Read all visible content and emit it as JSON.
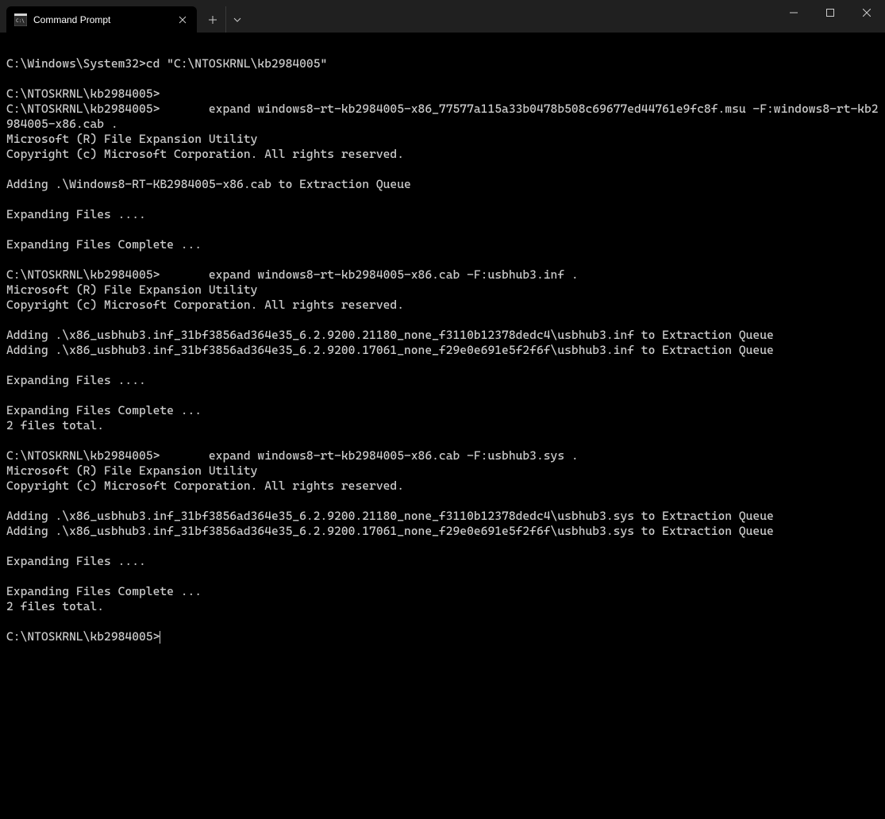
{
  "titlebar": {
    "tab_title": "Command Prompt"
  },
  "terminal": {
    "lines": [
      "C:\\Windows\\System32>cd \"C:\\NTOSKRNL\\kb2984005\"",
      "",
      "C:\\NTOSKRNL\\kb2984005>",
      "C:\\NTOSKRNL\\kb2984005>       expand windows8-rt-kb2984005-x86_77577a115a33b0478b508c69677ed44761e9fc8f.msu -F:windows8-rt-kb2984005-x86.cab .",
      "Microsoft (R) File Expansion Utility",
      "Copyright (c) Microsoft Corporation. All rights reserved.",
      "",
      "Adding .\\Windows8-RT-KB2984005-x86.cab to Extraction Queue",
      "",
      "Expanding Files ....",
      "",
      "Expanding Files Complete ...",
      "",
      "C:\\NTOSKRNL\\kb2984005>       expand windows8-rt-kb2984005-x86.cab -F:usbhub3.inf .",
      "Microsoft (R) File Expansion Utility",
      "Copyright (c) Microsoft Corporation. All rights reserved.",
      "",
      "Adding .\\x86_usbhub3.inf_31bf3856ad364e35_6.2.9200.21180_none_f3110b12378dedc4\\usbhub3.inf to Extraction Queue",
      "Adding .\\x86_usbhub3.inf_31bf3856ad364e35_6.2.9200.17061_none_f29e0e691e5f2f6f\\usbhub3.inf to Extraction Queue",
      "",
      "Expanding Files ....",
      "",
      "Expanding Files Complete ...",
      "2 files total.",
      "",
      "C:\\NTOSKRNL\\kb2984005>       expand windows8-rt-kb2984005-x86.cab -F:usbhub3.sys .",
      "Microsoft (R) File Expansion Utility",
      "Copyright (c) Microsoft Corporation. All rights reserved.",
      "",
      "Adding .\\x86_usbhub3.inf_31bf3856ad364e35_6.2.9200.21180_none_f3110b12378dedc4\\usbhub3.sys to Extraction Queue",
      "Adding .\\x86_usbhub3.inf_31bf3856ad364e35_6.2.9200.17061_none_f29e0e691e5f2f6f\\usbhub3.sys to Extraction Queue",
      "",
      "Expanding Files ....",
      "",
      "Expanding Files Complete ...",
      "2 files total.",
      "",
      "C:\\NTOSKRNL\\kb2984005>"
    ]
  }
}
